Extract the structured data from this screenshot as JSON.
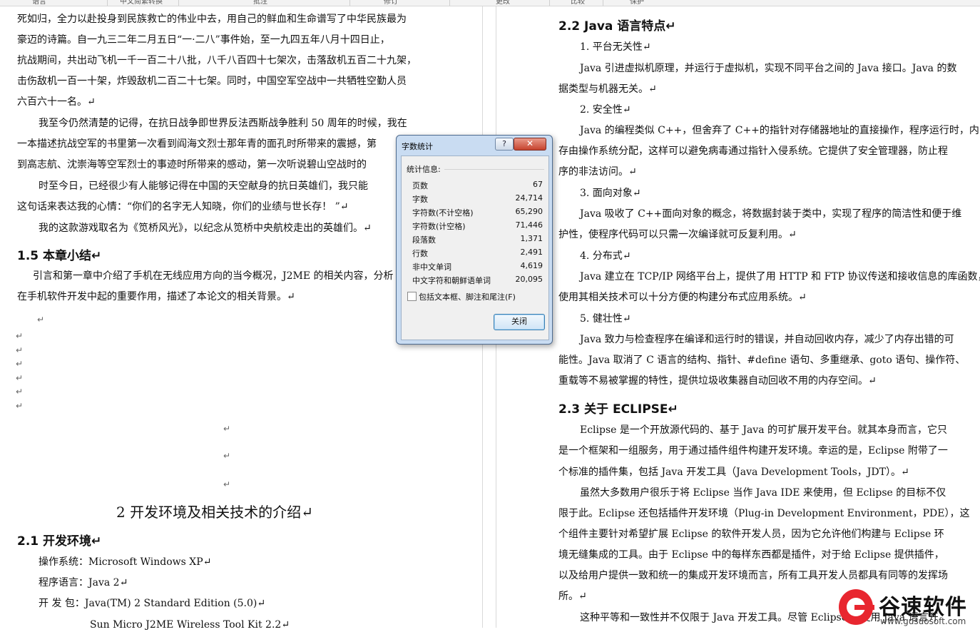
{
  "ribbon": {
    "groups": [
      "语言",
      "中文简繁转换",
      "批注",
      "修订",
      "更改",
      "比较",
      "保护"
    ]
  },
  "left": {
    "paragraphs": [
      "死如归，全力以赴投身到民族救亡的伟业中去，用自己的鲜血和生命谱写了中华民族最为",
      "豪迈的诗篇。自一九三二年二月五日“一·二八”事件始，至一九四五年八月十四日止，",
      "抗战期间，共出动飞机一千一百二十八批，八千八百四十七架次，击落敌机五百二十九架，",
      "击伤敌机一百一十架，炸毁敌机二百二十七架。同时，中国空军空战中一共牺牲空勤人员",
      "六百六十一名。↵",
      "我至今仍然清楚的记得，在抗日战争即世界反法西斯战争胜利 50 周年的时候，我在",
      "一本描述抗战空军的书里第一次看到阎海文烈士那年青的面孔时所带来的震撼，第",
      "到高志航、沈崇海等空军烈士的事迹时所带来的感动，第一次听说碧山空战时的",
      "时至今日，已经很少有人能够记得在中国的天空献身的抗日英雄们，我只能",
      "这句话来表达我的心情：“你们的名字无人知晓，你们的业绩与世长存！ ”↵",
      "我的这款游戏取名为《笕桥风光》，以纪念从笕桥中央航校走出的英雄们。↵"
    ],
    "heading_1_5": "1.5  本章小结↵",
    "summary": [
      "引言和第一章中介绍了手机在无线应用方向的当今概况，J2ME 的相关内容，分析",
      "在手机软件开发中起的重要作用，描述了本论文的相关背景。↵"
    ],
    "chapter_title": "2   开发环境及相关技术的介绍↵",
    "heading_2_1": "2.1   开发环境↵",
    "env": [
      "操作系统：Microsoft Windows XP↵",
      "程序语言：Java 2↵",
      "开  发  包：Java(TM) 2 Standard Edition (5.0)↵",
      "Sun Micro  J2ME      Wireless Tool Kit 2.2↵"
    ],
    "return_mark": "↵"
  },
  "right": {
    "heading_2_2": "2.2    Java 语言特点↵",
    "lines": [
      "1.  平台无关性↵",
      "Java 引进虚拟机原理，并运行于虚拟机，实现不同平台之间的 Java 接口。Java 的数",
      "据类型与机器无关。↵",
      "2.  安全性↵",
      "Java 的编程类似 C++，但舍弃了 C++的指针对存储器地址的直接操作，程序运行时，内",
      "存由操作系统分配，这样可以避免病毒通过指针入侵系统。它提供了安全管理器，防止程",
      "序的非法访问。↵",
      "3.  面向对象↵",
      "Java 吸收了 C++面向对象的概念，将数据封装于类中，实现了程序的简洁性和便于维",
      "护性，使程序代码可以只需一次编译就可反复利用。↵",
      "4.  分布式↵",
      "Java 建立在 TCP/IP 网络平台上，提供了用 HTTP 和 FTP 协议传送和接收信息的库函数，",
      "使用其相关技术可以十分方便的构建分布式应用系统。↵",
      "5.  健壮性↵",
      "Java 致力与检查程序在编译和运行时的错误，并自动回收内存，减少了内存出错的可",
      "能性。Java 取消了 C 语言的结构、指针、#define 语句、多重继承、goto 语句、操作符、",
      "重载等不易被掌握的特性，提供垃圾收集器自动回收不用的内存空间。↵"
    ],
    "heading_2_3": "2.3    关于 ECLIPSE↵",
    "eclipse": [
      "Eclipse 是一个开放源代码的、基于 Java 的可扩展开发平台。就其本身而言，它只",
      "是一个框架和一组服务，用于通过插件组件构建开发环境。幸运的是，Eclipse 附带了一",
      "个标准的插件集，包括 Java 开发工具（Java Development Tools，JDT）。↵",
      "虽然大多数用户很乐于将 Eclipse 当作 Java IDE 来使用，但 Eclipse 的目标不仅",
      "限于此。Eclipse 还包括插件开发环境（Plug-in Development Environment，PDE），这",
      "个组件主要针对希望扩展 Eclipse 的软件开发人员，因为它允许他们构建与 Eclipse 环",
      "境无缝集成的工具。由于 Eclipse 中的每样东西都是插件，对于给 Eclipse 提供插件，",
      "以及给用户提供一致和统一的集成开发环境而言，所有工具开发人员都具有同等的发挥场",
      "所。↵",
      "这种平等和一致性并不仅限于 Java 开发工具。尽管 Eclipse 是使用 Java 语言开"
    ]
  },
  "dialog": {
    "title": "字数统计",
    "help": "?",
    "close_x": "✕",
    "group_label": "统计信息:",
    "stats": [
      {
        "label": "页数",
        "value": "67"
      },
      {
        "label": "字数",
        "value": "24,714"
      },
      {
        "label": "字符数(不计空格)",
        "value": "65,290"
      },
      {
        "label": "字符数(计空格)",
        "value": "71,446"
      },
      {
        "label": "段落数",
        "value": "1,371"
      },
      {
        "label": "行数",
        "value": "2,491"
      },
      {
        "label": "非中文单词",
        "value": "4,619"
      },
      {
        "label": "中文字符和朝鲜语单词",
        "value": "20,095"
      }
    ],
    "checkbox_label": "包括文本框、脚注和尾注(F)",
    "close_button": "关闭"
  },
  "watermark": {
    "name": "谷速软件",
    "url": "www.gusuosoft.com"
  }
}
